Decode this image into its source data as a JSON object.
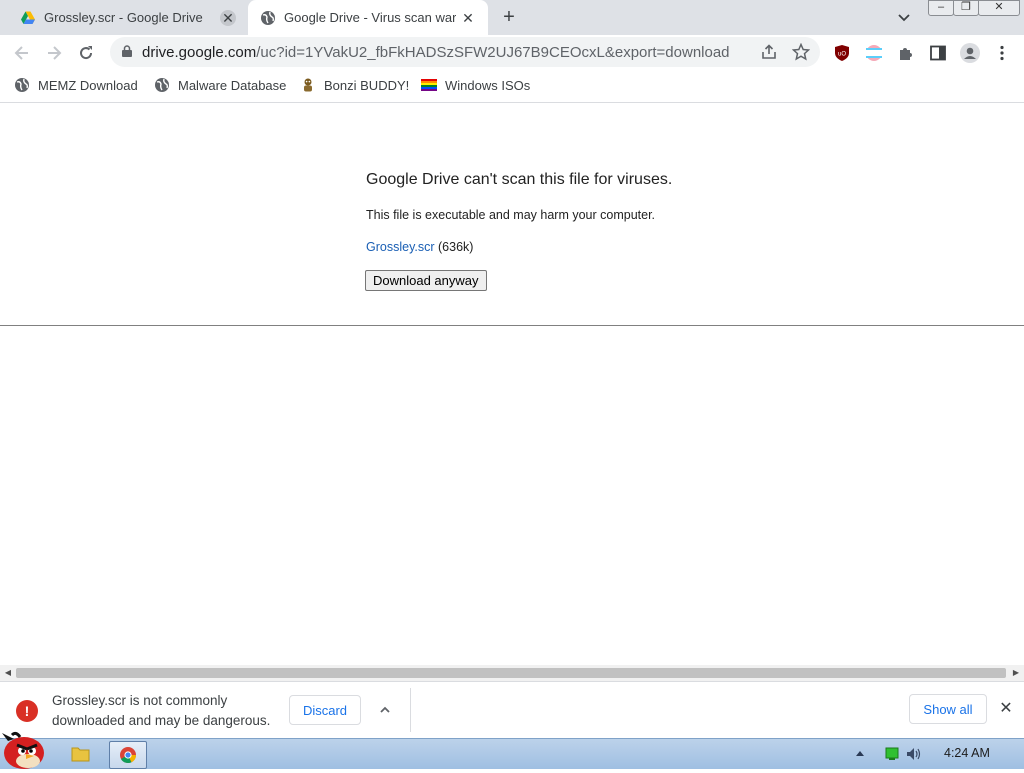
{
  "tabs": [
    {
      "title": "Grossley.scr - Google Drive",
      "favicon": "google-drive-icon",
      "active": false
    },
    {
      "title": "Google Drive - Virus scan war",
      "favicon": "globe-icon",
      "active": true
    }
  ],
  "window_controls": {
    "minimize": "–",
    "restore": "❐",
    "close": "✕"
  },
  "omnibox": {
    "host": "drive.google.com",
    "path": "/uc?id=1YVakU2_fbFkHADSzSFW2UJ67B9CEOcxL&export=download"
  },
  "bookmarks": [
    {
      "label": "MEMZ Download",
      "icon": "globe-icon"
    },
    {
      "label": "Malware Database",
      "icon": "globe-icon"
    },
    {
      "label": "Bonzi BUDDY!",
      "icon": "bonzi-icon"
    },
    {
      "label": "Windows ISOs",
      "icon": "rainbow-flag-icon"
    }
  ],
  "page": {
    "heading": "Google Drive can't scan this file for viruses.",
    "message": "This file is executable and may harm your computer.",
    "file_name": "Grossley.scr",
    "file_size": " (636k)",
    "button_label": "Download anyway"
  },
  "download_shelf": {
    "message": "Grossley.scr is not commonly downloaded and may be dangerous.",
    "discard_label": "Discard",
    "show_all_label": "Show all"
  },
  "taskbar": {
    "clock": "4:24 AM"
  },
  "colors": {
    "tabstrip": "#dee1e6",
    "link": "#1a5fb4",
    "warning": "#d93025",
    "accent": "#1a73e8"
  }
}
